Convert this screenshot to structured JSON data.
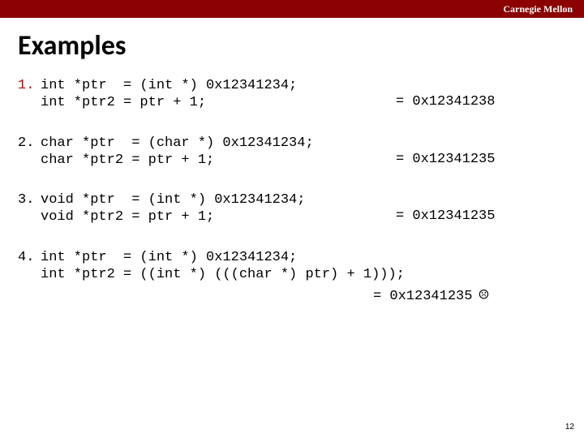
{
  "header": {
    "brand": "Carnegie Mellon"
  },
  "title": "Examples",
  "examples": [
    {
      "num": "1.",
      "line1": "int *ptr  = (int *) 0x12341234;",
      "line2": "int *ptr2 = ptr + 1;",
      "answer": "= 0x12341238"
    },
    {
      "num": "2.",
      "line1": "char *ptr  = (char *) 0x12341234;",
      "line2": "char *ptr2 = ptr + 1;",
      "answer": "= 0x12341235"
    },
    {
      "num": "3.",
      "line1": "void *ptr  = (int *) 0x12341234;",
      "line2": "void *ptr2 = ptr + 1;",
      "answer": "= 0x12341235"
    },
    {
      "num": "4.",
      "line1": "int *ptr  = (int *) 0x12341234;",
      "line2": "int *ptr2 = ((int *) (((char *) ptr) + 1)));",
      "answer": "= 0x12341235",
      "icon": "sad-face"
    }
  ],
  "page_number": "12",
  "icons": {
    "sad-face": "☹"
  }
}
